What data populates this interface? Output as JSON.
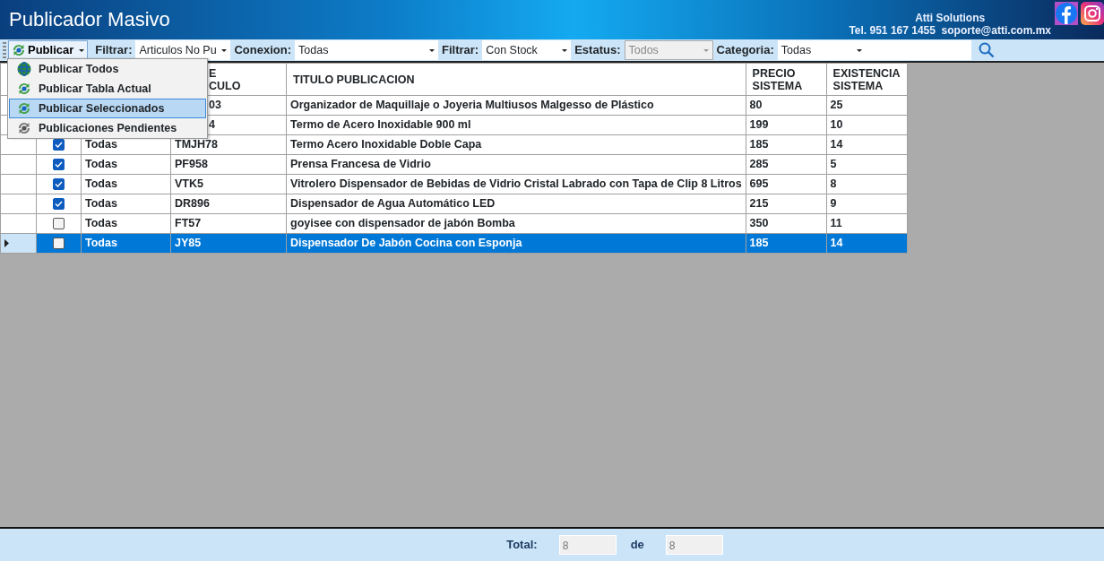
{
  "window": {
    "title": "Publicador Masivo"
  },
  "contact": {
    "company": "Atti Solutions",
    "line": "Tel. 951 167 1455  soporte@atti.com.mx"
  },
  "toolbar": {
    "publish_button": "Publicar",
    "filters": [
      {
        "label": "Filtrar:",
        "value": "Articulos No Pu",
        "disabled": false
      },
      {
        "label": "Conexion:",
        "value": "Todas",
        "disabled": false
      },
      {
        "label": "Filtrar:",
        "value": "Con Stock",
        "disabled": false
      },
      {
        "label": "Estatus:",
        "value": "Todos",
        "disabled": true
      },
      {
        "label": "Categoria:",
        "value": "Todas",
        "disabled": false
      }
    ]
  },
  "menu": {
    "items": [
      {
        "label": "Publicar Todos",
        "kind": "globe",
        "selected": false
      },
      {
        "label": "Publicar Tabla Actual",
        "kind": "sync",
        "selected": false
      },
      {
        "label": "Publicar Seleccionados",
        "kind": "sync",
        "selected": true
      },
      {
        "label": "Publicaciones Pendientes",
        "kind": "pending",
        "selected": false
      }
    ]
  },
  "table": {
    "columns": [
      {
        "lines": [
          "E",
          "CULO"
        ]
      },
      {
        "lines": [
          "TITULO PUBLICACION"
        ]
      },
      {
        "lines": [
          "PRECIO",
          "SISTEMA"
        ]
      },
      {
        "lines": [
          "EXISTENCIA",
          "SISTEMA"
        ]
      }
    ],
    "rows": [
      {
        "clave": "03",
        "titulo": "Organizador de Maquillaje o Joyeria Multiusos Malgesso de Plástico",
        "precio": "80",
        "existencia": "25",
        "selected": false
      },
      {
        "clave": "4",
        "titulo": "Termo de Acero Inoxidable 900 ml",
        "precio": "199",
        "existencia": "10",
        "selected": false
      },
      {
        "checked": true,
        "conexion": "Todas",
        "clave": "TMJH78",
        "titulo": "Termo Acero Inoxidable Doble Capa",
        "precio": "185",
        "existencia": "14",
        "selected": false
      },
      {
        "checked": true,
        "conexion": "Todas",
        "clave": "PF958",
        "titulo": "Prensa Francesa de Vidrio",
        "precio": "285",
        "existencia": "5",
        "selected": false
      },
      {
        "checked": true,
        "conexion": "Todas",
        "clave": "VTK5",
        "titulo": "Vitrolero Dispensador de Bebidas de Vidrio Cristal Labrado con Tapa de Clip 8 Litros",
        "precio": "695",
        "existencia": "8",
        "selected": false
      },
      {
        "checked": true,
        "conexion": "Todas",
        "clave": "DR896",
        "titulo": "Dispensador de Agua Automático LED",
        "precio": "215",
        "existencia": "9",
        "selected": false
      },
      {
        "checked": false,
        "conexion": "Todas",
        "clave": "FT57",
        "titulo": "goyisee con dispensador de jabón Bomba",
        "precio": "350",
        "existencia": "11",
        "selected": false
      },
      {
        "checked": false,
        "conexion": "Todas",
        "clave": "JY85",
        "titulo": "Dispensador De Jabón Cocina con Esponja",
        "precio": "185",
        "existencia": "14",
        "selected": true
      }
    ]
  },
  "footer": {
    "total_label": "Total:",
    "total": "8",
    "of_label": "de",
    "of": "8"
  }
}
